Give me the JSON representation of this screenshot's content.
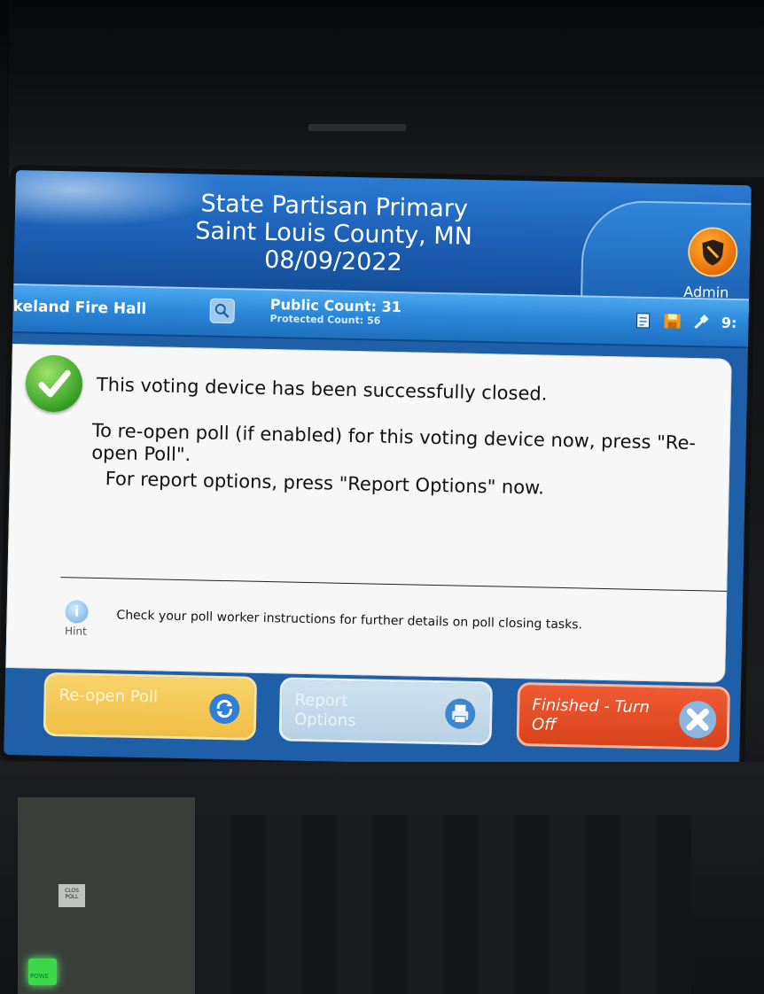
{
  "header": {
    "title_line1": "State Partisan Primary",
    "title_line2": "Saint Louis County, MN",
    "title_line3": "08/09/2022",
    "admin_label": "Admin",
    "admin_icon": "shield-icon"
  },
  "statusbar": {
    "location": "keland Fire Hall",
    "public_count": "Public Count: 31",
    "protected_count": "Protected Count: 56",
    "time_fragment": "9:",
    "icons": [
      "document-icon",
      "floppy-icon",
      "plug-icon"
    ]
  },
  "message": {
    "main": "This voting device has been successfully closed.",
    "reopen": "To re-open poll (if enabled) for this voting device now, press \"Re-open Poll\".",
    "report": "For report options, press \"Report Options\" now."
  },
  "hint": {
    "label": "Hint",
    "text": "Check your poll worker instructions for further details on poll closing tasks."
  },
  "buttons": {
    "reopen": "Re-open Poll",
    "report": "Report Options",
    "finish": "Finished - Turn Off"
  },
  "hardware": {
    "close_label": "CLOS POLL",
    "power_label": "POWE"
  },
  "colors": {
    "header_blue": "#1c5fb4",
    "reopen_yellow": "#f0be45",
    "report_gray_blue": "#b8d1e3",
    "finish_red": "#d9431c",
    "success_green": "#2f9a1e"
  }
}
